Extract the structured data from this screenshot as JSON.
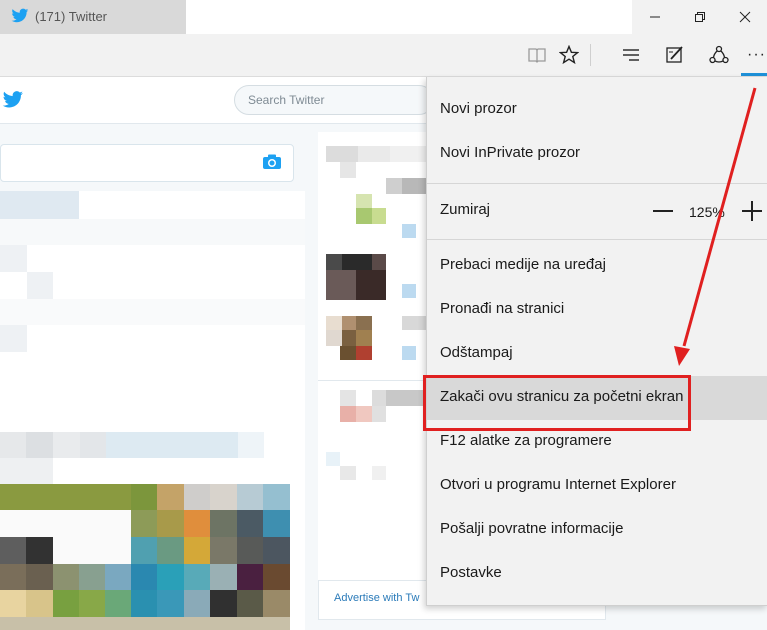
{
  "tab": {
    "title": "(171) Twitter"
  },
  "window_controls": [
    "minimize",
    "restore",
    "close"
  ],
  "toolbar": {
    "icons": [
      "reading-view-icon",
      "favorite-star-icon",
      "hub-icon",
      "web-note-icon",
      "share-icon",
      "more-icon"
    ],
    "more_label": "···"
  },
  "twitter": {
    "search_placeholder": "Search Twitter",
    "advertise_text": "Advertise with Tw"
  },
  "menu": {
    "items": [
      "Novi prozor",
      "Novi InPrivate prozor",
      "Zumiraj",
      "Prebaci medije na uređaj",
      "Pronađi na stranici",
      "Odštampaj",
      "Zakači ovu stranicu za početni ekran",
      "F12 alatke za programere",
      "Otvori u programu Internet Explorer",
      "Pošalji povratne informacije",
      "Postavke"
    ],
    "zoom_value": "125%",
    "highlighted_index": 6
  },
  "colors": {
    "accent": "#1e90d8",
    "twitter_blue": "#1da1f2",
    "annotation_red": "#e02020"
  }
}
